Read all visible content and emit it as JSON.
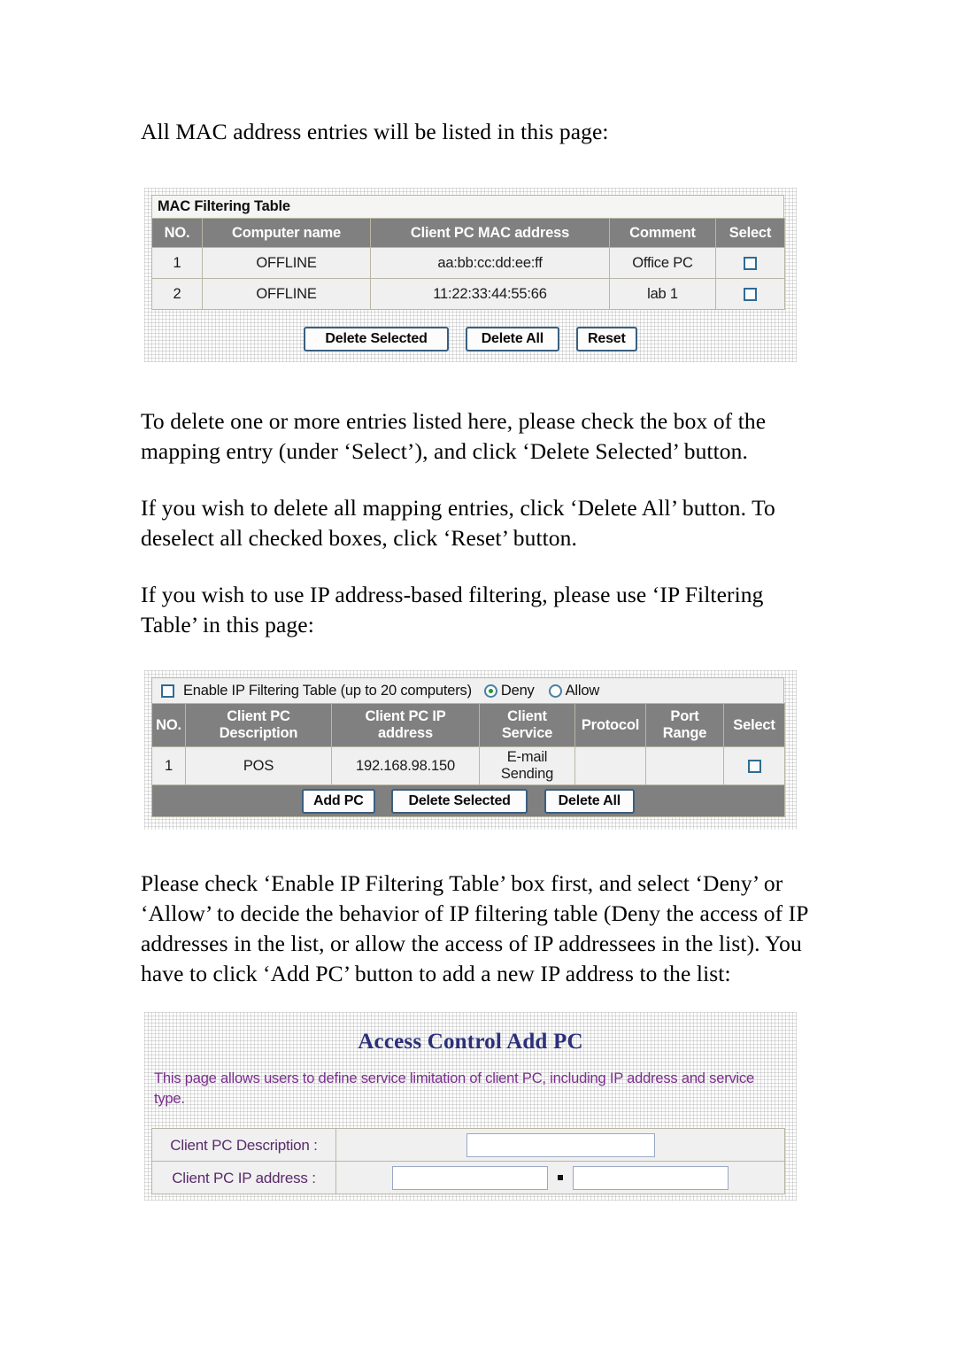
{
  "document": {
    "paragraphs": {
      "p1": "All MAC address entries will be listed in this page:",
      "p2": "To delete one or more entries listed here, please check the box of the mapping entry (under ‘Select’), and click ‘Delete Selected’ button.",
      "p3": "If you wish to delete all mapping entries, click ‘Delete All’ button. To deselect all checked boxes, click ‘Reset’ button.",
      "p4": "If you wish to use IP address-based filtering, please use ‘IP Filtering Table’ in this page:",
      "p5": "Please check ‘Enable IP Filtering Table’ box first, and select ‘Deny’ or ‘Allow’ to decide the behavior of IP filtering table (Deny the access of IP addresses in the list, or allow the access of IP addressees in the list). You have to click ‘Add PC’ button to add a new IP address to the list:"
    }
  },
  "mac_filtering_table": {
    "caption": "MAC Filtering Table",
    "columns": [
      "NO.",
      "Computer name",
      "Client PC MAC address",
      "Comment",
      "Select"
    ],
    "rows": [
      {
        "no": "1",
        "computer_name": "OFFLINE",
        "mac_address": "aa:bb:cc:dd:ee:ff",
        "comment": "Office PC",
        "selected": false
      },
      {
        "no": "2",
        "computer_name": "OFFLINE",
        "mac_address": "11:22:33:44:55:66",
        "comment": "lab 1",
        "selected": false
      }
    ],
    "buttons": {
      "delete_selected": "Delete Selected",
      "delete_all": "Delete All",
      "reset": "Reset"
    }
  },
  "ip_filtering_table": {
    "enable_label": "Enable IP Filtering Table (up to 20 computers)",
    "enable_checked": false,
    "mode_options": [
      "Deny",
      "Allow"
    ],
    "mode_selected": "Deny",
    "columns": [
      "NO.",
      "Client PC Description",
      "Client PC IP address",
      "Client Service",
      "Protocol",
      "Port Range",
      "Select"
    ],
    "column_lines": [
      [
        "NO."
      ],
      [
        "Client PC",
        "Description"
      ],
      [
        "Client PC IP",
        "address"
      ],
      [
        "Client",
        "Service"
      ],
      [
        "Protocol"
      ],
      [
        "Port",
        "Range"
      ],
      [
        "Select"
      ]
    ],
    "rows": [
      {
        "no": "1",
        "description": "POS",
        "ip_address": "192.168.98.150",
        "service_line1": "E-mail",
        "service_line2": "Sending",
        "protocol": "",
        "port_range": "",
        "selected": false
      }
    ],
    "buttons": {
      "add_pc": "Add PC",
      "delete_selected": "Delete Selected",
      "delete_all": "Delete All"
    }
  },
  "access_control_add_pc": {
    "title": "Access Control Add PC",
    "description": "This page allows users to define service limitation of client PC, including IP address and service type.",
    "fields": [
      {
        "label": "Client PC Description :",
        "value": "",
        "placeholder": ""
      },
      {
        "label": "Client PC IP address :",
        "value_a": "",
        "value_b": "",
        "separator": "."
      }
    ]
  },
  "colors": {
    "table_header_bg": "#808080",
    "table_cell_bg": "#f0f0f0",
    "table_border": "#b9b6a4",
    "button_border": "#3a5f80",
    "title_navy": "#2b2f7a",
    "desc_purple": "#7b2f8e",
    "radio_dot_green": "#1f9a2e",
    "checkbox_border": "#2f6b92"
  }
}
